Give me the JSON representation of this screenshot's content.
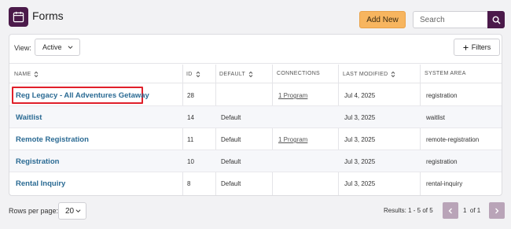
{
  "header": {
    "title": "Forms",
    "icon": "calendar-form-icon",
    "add_label": "Add New",
    "search_placeholder": "Search",
    "brand_color": "#4b1a4a",
    "accent_color": "#f7b55f"
  },
  "toolbar": {
    "view_label": "View:",
    "view_value": "Active",
    "filters_label": "Filters"
  },
  "table": {
    "columns": [
      "NAME",
      "ID",
      "DEFAULT",
      "CONNECTIONS",
      "LAST MODIFIED",
      "SYSTEM AREA"
    ],
    "rows": [
      {
        "name": "Reg Legacy - All Adventures Getaway",
        "id": "28",
        "default": "",
        "connections": "1 Program",
        "modified": "Jul 4, 2025",
        "area": "registration",
        "highlighted": true
      },
      {
        "name": "Waitlist",
        "id": "14",
        "default": "Default",
        "connections": "",
        "modified": "Jul 3, 2025",
        "area": "waitlist"
      },
      {
        "name": "Remote Registration",
        "id": "11",
        "default": "Default",
        "connections": "1 Program",
        "modified": "Jul 3, 2025",
        "area": "remote-registration"
      },
      {
        "name": "Registration",
        "id": "10",
        "default": "Default",
        "connections": "",
        "modified": "Jul 3, 2025",
        "area": "registration"
      },
      {
        "name": "Rental Inquiry",
        "id": "8",
        "default": "Default",
        "connections": "",
        "modified": "Jul 3, 2025",
        "area": "rental-inquiry"
      }
    ]
  },
  "footer": {
    "rows_label": "Rows per page:",
    "rows_value": "20",
    "results": "Results: 1 - 5 of 5",
    "page": "1",
    "of_label": "of 1"
  }
}
